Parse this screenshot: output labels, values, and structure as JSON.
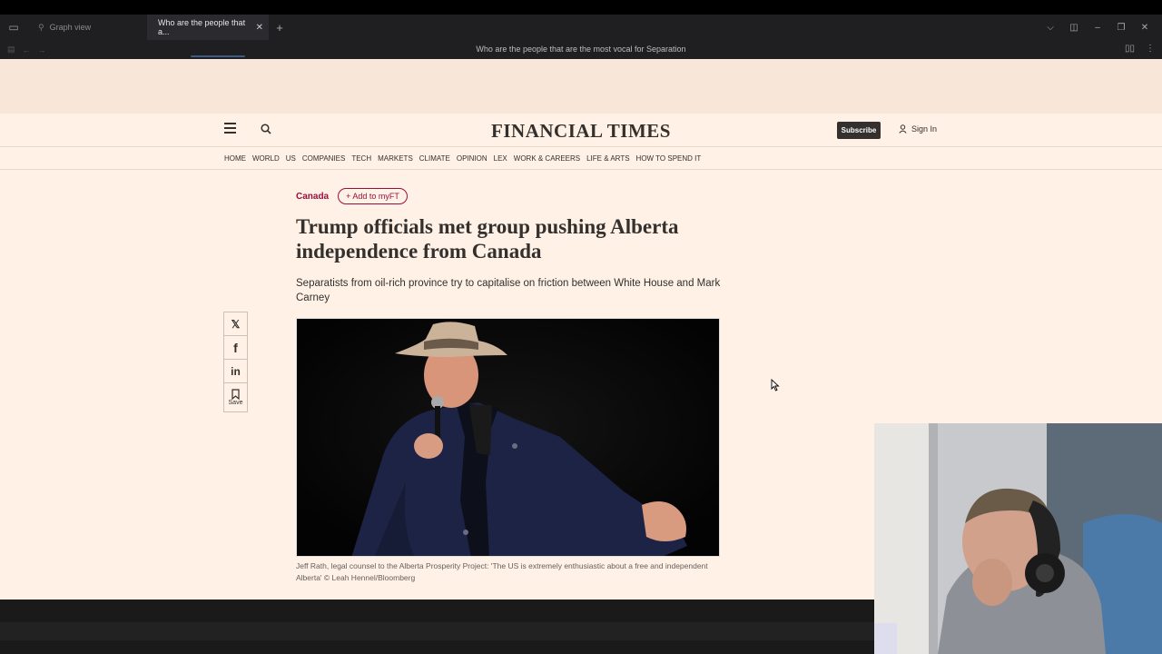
{
  "browser": {
    "tabs": [
      {
        "label": "Graph view",
        "active": false
      },
      {
        "label": "Who are the people that a...",
        "active": true
      }
    ],
    "page_title": "Who are the people that are the most vocal for Separation"
  },
  "ft": {
    "logo": "FINANCIAL TIMES",
    "subscribe_label": "Subscribe",
    "signin_label": "Sign In",
    "nav": [
      "HOME",
      "WORLD",
      "US",
      "COMPANIES",
      "TECH",
      "MARKETS",
      "CLIMATE",
      "OPINION",
      "LEX",
      "WORK & CAREERS",
      "LIFE & ARTS",
      "HOW TO SPEND IT"
    ]
  },
  "article": {
    "topic": "Canada",
    "add_myft": "Add to myFT",
    "headline": "Trump officials met group pushing Alberta independence from Canada",
    "standfirst": "Separatists from oil-rich province try to capitalise on friction between White House and Mark Carney",
    "caption": "Jeff Rath, legal counsel to the Alberta Prosperity Project: 'The US is extremely enthusiastic about a free and independent Alberta' © Leah Hennel/Bloomberg",
    "save_label": "Save"
  },
  "share": {
    "x": "𝕏",
    "facebook": "f",
    "linkedin": "in"
  }
}
